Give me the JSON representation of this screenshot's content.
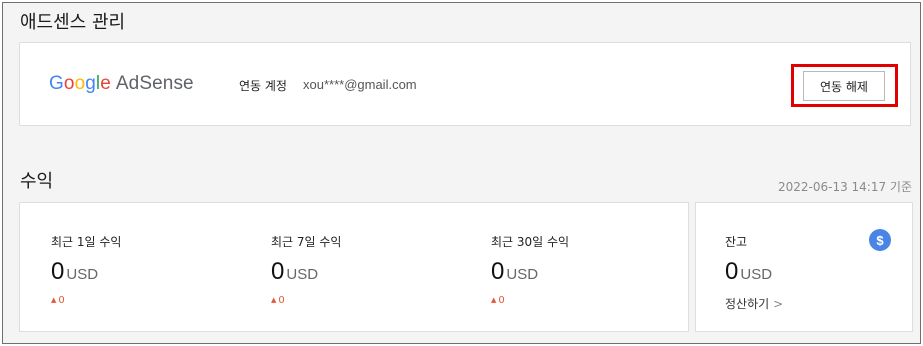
{
  "adsense_section": {
    "title": "애드센스 관리",
    "logo": {
      "google": [
        "G",
        "o",
        "o",
        "g",
        "l",
        "e"
      ],
      "product": "AdSense"
    },
    "account_label": "연동 계정",
    "account_value": "xou****@gmail.com",
    "disconnect_button": "연동 해제",
    "highlight_color": "#e00000"
  },
  "revenue_section": {
    "title": "수익",
    "timestamp": "2022-06-13 14:17 기준",
    "metrics": [
      {
        "label": "최근 1일 수익",
        "value": "0",
        "unit": "USD",
        "change": "0"
      },
      {
        "label": "최근 7일 수익",
        "value": "0",
        "unit": "USD",
        "change": "0"
      },
      {
        "label": "최근 30일 수익",
        "value": "0",
        "unit": "USD",
        "change": "0"
      }
    ],
    "balance": {
      "label": "잔고",
      "value": "0",
      "unit": "USD",
      "link": "정산하기",
      "icon": "dollar-icon",
      "icon_glyph": "$",
      "icon_color": "#4a85e6"
    },
    "change_color": "#e05a3a"
  }
}
